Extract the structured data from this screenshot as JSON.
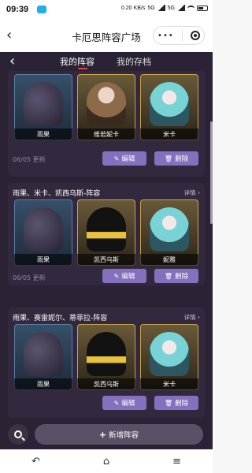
{
  "status": {
    "time": "09:39",
    "net": "0.20 KB/s",
    "sig1": "5G",
    "sig2": "5G"
  },
  "miniapp": {
    "title": "卡厄思阵容广场",
    "back": "‹",
    "dots": "•••"
  },
  "tabs": {
    "back": "‹",
    "mine": "我的阵容",
    "saved": "我的存档"
  },
  "cards": [
    {
      "title": "",
      "chars": [
        "雨果",
        "维若妮卡",
        "米卡"
      ],
      "date": "06/05 更新",
      "edit": "编辑",
      "del": "删除"
    },
    {
      "title": "雨果、米卡、凯西乌斯-阵容",
      "detail": "详情 ›",
      "chars": [
        "雨果",
        "凯西乌斯",
        "妮雅"
      ],
      "date": "06/05 更新",
      "edit": "编辑",
      "del": "删除"
    },
    {
      "title": "雨果、赛雷妮尔、蒂菲拉-阵容",
      "detail": "详情 ›",
      "chars": [
        "雨果",
        "凯西乌斯",
        "米卡"
      ],
      "date": "",
      "edit": "编辑",
      "del": "删除"
    }
  ],
  "bottom": {
    "add": "新增阵容"
  },
  "navbar": {
    "back": "↶",
    "home": "⌂",
    "menu": "≡"
  }
}
